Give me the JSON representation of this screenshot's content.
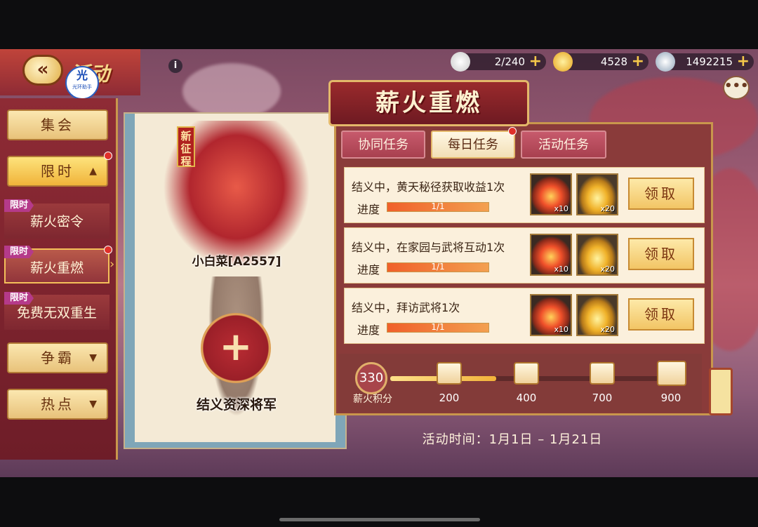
{
  "header": {
    "activity_title": "活动",
    "watermark_main": "光",
    "watermark_sub": "光环助手",
    "info_label": "i"
  },
  "resources": [
    {
      "icon": "stamina-bun-icon",
      "value": "2/240"
    },
    {
      "icon": "gold-ingot-icon",
      "value": "4528"
    },
    {
      "icon": "silver-coin-icon",
      "value": "1492215"
    }
  ],
  "sidebar": {
    "items": [
      {
        "label": "集会",
        "type": "button"
      },
      {
        "label": "限时",
        "type": "button",
        "arrow": "▲"
      },
      {
        "tag": "限时",
        "label": "薪火密令"
      },
      {
        "tag": "限时",
        "label": "薪火重燃"
      },
      {
        "tag": "限时",
        "label": "免费无双重生"
      },
      {
        "label": "争霸",
        "type": "button",
        "arrow": "▼"
      },
      {
        "label": "热点",
        "type": "button",
        "arrow": "▼"
      }
    ]
  },
  "hero": {
    "badge": "新征程",
    "name": "小白菜[A2557]",
    "recruit_label": "结义资深将军",
    "add_symbol": "+"
  },
  "event": {
    "title": "薪火重燃",
    "tabs": [
      {
        "label": "协同任务"
      },
      {
        "label": "每日任务"
      },
      {
        "label": "活动任务"
      }
    ],
    "progress_label": "进度",
    "claim_label": "领取",
    "tasks": [
      {
        "desc": "结义中，黄天秘径获取收益1次",
        "progress_text": "1/1",
        "progress": 1.0,
        "reward_1": "x10",
        "reward_2": "x20"
      },
      {
        "desc": "结义中，在家园与武将互动1次",
        "progress_text": "1/1",
        "progress": 1.0,
        "reward_1": "x10",
        "reward_2": "x20"
      },
      {
        "desc": "结义中，拜访武将1次",
        "progress_text": "1/1",
        "progress": 1.0,
        "reward_1": "x10",
        "reward_2": "x20"
      }
    ],
    "points": {
      "value": "330",
      "label": "薪火积分",
      "milestones": [
        "200",
        "400",
        "700",
        "900"
      ],
      "fill_fraction": 0.36
    },
    "time": "活动时间：1月1日 – 1月21日"
  },
  "colors": {
    "accent_gold": "#f3b33a",
    "panel_red": "#8a3b3a",
    "alert_red": "#e0302a"
  }
}
